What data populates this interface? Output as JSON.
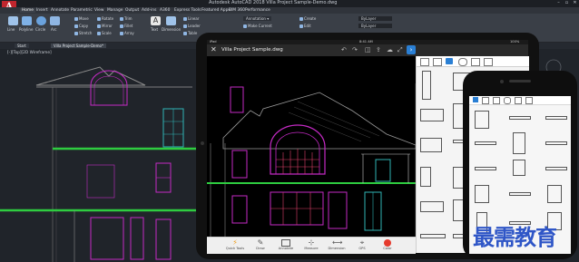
{
  "acad": {
    "app_title": "Autodesk AutoCAD 2018  Villa Project Sample-Demo.dwg",
    "logo_letter": "A",
    "tabs": [
      "Home",
      "Insert",
      "Annotate",
      "Parametric",
      "View",
      "Manage",
      "Output",
      "Add-ins",
      "A360",
      "Express Tools",
      "Featured Apps",
      "BIM 360",
      "Performance"
    ],
    "ribbon": {
      "draw_tools": [
        "Line",
        "Polyline",
        "Circle",
        "Arc"
      ],
      "modify_tools": [
        "Move",
        "Copy",
        "Stretch",
        "Rotate",
        "Mirror",
        "Scale",
        "Trim",
        "Fillet",
        "Array"
      ],
      "annotation_tools": [
        "Text",
        "Dimension"
      ],
      "linear": "Linear",
      "leader": "Leader",
      "table": "Table",
      "annotation": "Annotation",
      "make_current": "Make Current",
      "create": "Create",
      "edit": "Edit",
      "bylayer_1": "ByLayer",
      "bylayer_2": "ByLayer",
      "panel_draw": "Draw",
      "panel_modify": "Modify",
      "panel_annotation": "Annotation"
    },
    "doc_tabs": [
      "Start",
      "Villa Project Sample-Demo*"
    ],
    "view_label": "[-][Top][2D Wireframe]"
  },
  "tablet": {
    "status_left": "iPad",
    "status_center": "8:41 AM",
    "status_right": "100%",
    "file_title": "Villa Project Sample.dwg",
    "bottom_tools": [
      "Quick Tools",
      "Draw",
      "Annotate",
      "Measure",
      "Dimension",
      "GPS",
      "Color"
    ],
    "palette_blocks": [
      "door-vert",
      "window-dbl",
      "window-sgl",
      "window-sgl",
      "window-tall",
      "window-sgl",
      "window-h1",
      "window-h2",
      "door-gar",
      "window-h3",
      "window-h4",
      "window-h5",
      "window-pair",
      "window-sgl",
      "window-sgl",
      "slim-bar",
      "slim-bar",
      "window-sgl"
    ]
  },
  "phone": {
    "status_center": "8:41 AM",
    "blocks": [
      "window",
      "slim",
      "slim",
      "slim",
      "door",
      "slim",
      "slim",
      "window",
      "slim",
      "window",
      "slim",
      "window",
      "door",
      "slim",
      "window"
    ]
  },
  "watermark": "最需教育",
  "colors": {
    "cad_bg": "#20242a",
    "building_line": "#c42ac4",
    "grade_line": "#2ecc40",
    "accent_blue": "#2a7fd4",
    "record_red": "#e53a2d"
  }
}
